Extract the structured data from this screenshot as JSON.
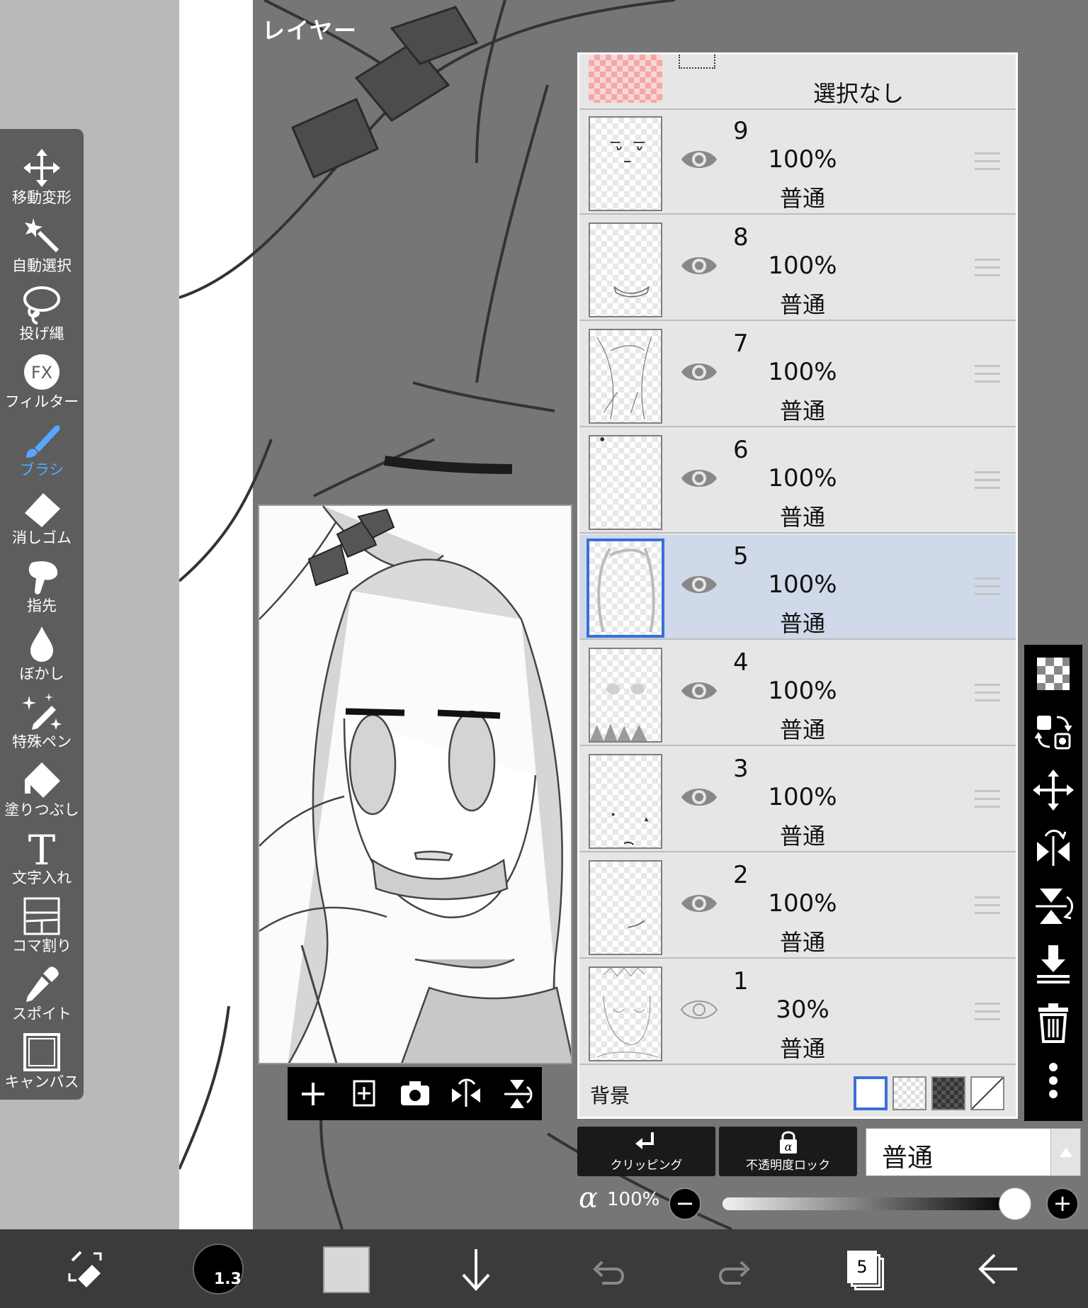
{
  "panel_title": "レイヤー",
  "toolbar": {
    "tools": [
      {
        "name": "move-transform",
        "label": "移動変形",
        "active": false
      },
      {
        "name": "magic-wand",
        "label": "自動選択",
        "active": false
      },
      {
        "name": "lasso",
        "label": "投げ縄",
        "active": false
      },
      {
        "name": "filter",
        "label": "フィルター",
        "active": false,
        "icon_text": "FX"
      },
      {
        "name": "brush",
        "label": "ブラシ",
        "active": true
      },
      {
        "name": "eraser",
        "label": "消しゴム",
        "active": false
      },
      {
        "name": "smudge",
        "label": "指先",
        "active": false
      },
      {
        "name": "blur",
        "label": "ぼかし",
        "active": false
      },
      {
        "name": "special-pen",
        "label": "特殊ペン",
        "active": false
      },
      {
        "name": "fill",
        "label": "塗りつぶし",
        "active": false
      },
      {
        "name": "text",
        "label": "文字入れ",
        "active": false,
        "icon_text": "T"
      },
      {
        "name": "frame-divider",
        "label": "コマ割り",
        "active": false
      },
      {
        "name": "eyedropper",
        "label": "スポイト",
        "active": false
      },
      {
        "name": "canvas",
        "label": "キャンバス",
        "active": false
      }
    ]
  },
  "layers": {
    "selection_label": "選択なし",
    "items": [
      {
        "name": "9",
        "opacity": "100%",
        "mode": "普通",
        "visible": true,
        "selected": false
      },
      {
        "name": "8",
        "opacity": "100%",
        "mode": "普通",
        "visible": true,
        "selected": false
      },
      {
        "name": "7",
        "opacity": "100%",
        "mode": "普通",
        "visible": true,
        "selected": false
      },
      {
        "name": "6",
        "opacity": "100%",
        "mode": "普通",
        "visible": true,
        "selected": false
      },
      {
        "name": "5",
        "opacity": "100%",
        "mode": "普通",
        "visible": true,
        "selected": true
      },
      {
        "name": "4",
        "opacity": "100%",
        "mode": "普通",
        "visible": true,
        "selected": false
      },
      {
        "name": "3",
        "opacity": "100%",
        "mode": "普通",
        "visible": true,
        "selected": false
      },
      {
        "name": "2",
        "opacity": "100%",
        "mode": "普通",
        "visible": true,
        "selected": false
      },
      {
        "name": "1",
        "opacity": "30%",
        "mode": "普通",
        "visible": false,
        "selected": false
      }
    ],
    "background_label": "背景"
  },
  "controls": {
    "clipping_label": "クリッピング",
    "lock_label": "不透明度ロック",
    "blend_mode": "普通",
    "alpha_symbol": "α",
    "alpha_value": "100%",
    "alpha_fraction": 1.0,
    "minus": "−",
    "plus": "+"
  },
  "bottom_bar": {
    "brush_size": "1.3",
    "layer_count": "5"
  },
  "colors": {
    "accent": "#56a8ff",
    "selected_row": "#cfd9e9",
    "selected_border": "#3a6fd6",
    "primary_color": "#d8d8d8"
  }
}
